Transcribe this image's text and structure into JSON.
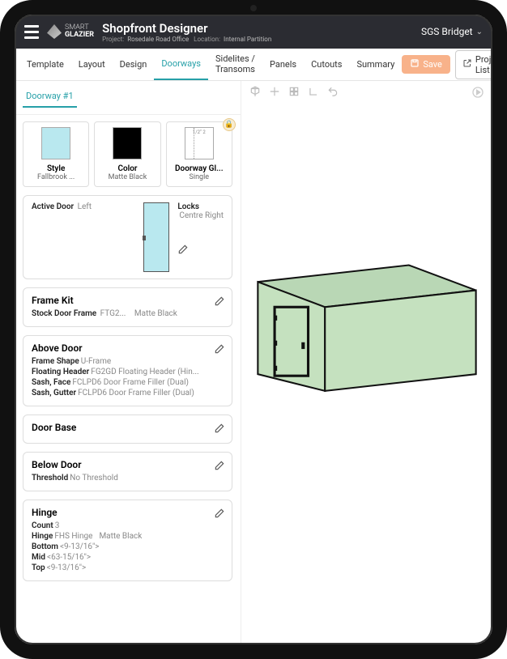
{
  "brand": {
    "line1": "SMART",
    "line2": "GLAZIER"
  },
  "header": {
    "title": "Shopfront Designer",
    "project_label": "Project:",
    "project_value": "Rosedale Road Office",
    "location_label": "Location:",
    "location_value": "Internal Partition",
    "user": "SGS Bridget"
  },
  "tabs": {
    "template": "Template",
    "layout": "Layout",
    "design": "Design",
    "doorways": "Doorways",
    "sidelites": "Sidelites / Transoms",
    "panels": "Panels",
    "cutouts": "Cutouts",
    "summary": "Summary"
  },
  "actions": {
    "save": "Save",
    "project_list": "Project List"
  },
  "subtab": "Doorway #1",
  "selectors": {
    "style": {
      "label": "Style",
      "value": "Fallbrook ..."
    },
    "color": {
      "label": "Color",
      "value": "Matte Black"
    },
    "glass": {
      "label": "Doorway Gl...",
      "value": "Single",
      "dims": "1/2\"   2"
    }
  },
  "active_door": {
    "title_k": "Active Door",
    "title_v": "Left",
    "locks_k": "Locks",
    "locks_v": "Centre Right"
  },
  "frame_kit": {
    "title": "Frame Kit",
    "row_k": "Stock Door Frame",
    "row_v": "FTG2...",
    "row_v2": "Matte Black"
  },
  "above_door": {
    "title": "Above Door",
    "r1_k": "Frame Shape",
    "r1_v": "U-Frame",
    "r2_k": "Floating Header",
    "r2_v": "FG2GD Floating Header (Hin...",
    "r3_k": "Sash, Face",
    "r3_v": "FCLPD6 Door Frame Filler (Dual)",
    "r4_k": "Sash, Gutter",
    "r4_v": "FCLPD6 Door Frame Filler (Dual)"
  },
  "door_base": {
    "title": "Door Base"
  },
  "below_door": {
    "title": "Below Door",
    "r1_k": "Threshold",
    "r1_v": "No Threshold"
  },
  "hinge": {
    "title": "Hinge",
    "count_k": "Count",
    "count_v": "3",
    "hinge_k": "Hinge",
    "hinge_v": "FHS Hinge",
    "hinge_v2": "Matte Black",
    "bottom_k": "Bottom",
    "bottom_v": "<9-13/16\">",
    "mid_k": "Mid",
    "mid_v": "<63-15/16\">",
    "top_k": "Top",
    "top_v": "<9-13/16\">"
  }
}
